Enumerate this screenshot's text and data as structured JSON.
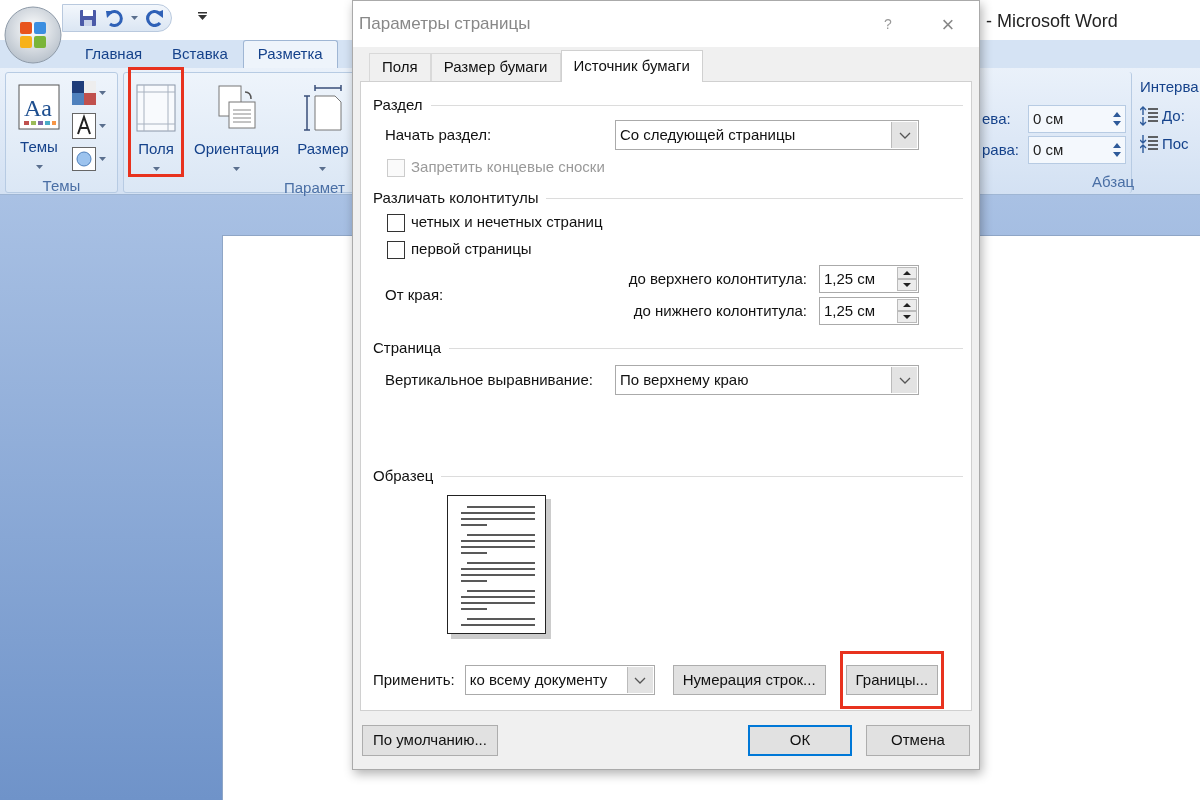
{
  "word": {
    "title": "- Microsoft Word",
    "ribbon_tabs": [
      {
        "label": "Главная",
        "selected": false
      },
      {
        "label": "Вставка",
        "selected": false
      },
      {
        "label": "Разметка",
        "selected": true
      }
    ],
    "ribbon_groups": [
      {
        "label": "Темы",
        "buttons": [
          {
            "label": "Темы",
            "kind": "themes",
            "icon_text": "Aa",
            "highlighted": false
          }
        ]
      },
      {
        "label": "Парамет",
        "buttons": [
          {
            "label": "Поля",
            "kind": "margins",
            "highlighted": true
          },
          {
            "label": "Ориентация",
            "kind": "orientation",
            "highlighted": false
          },
          {
            "label": "Размер",
            "kind": "size",
            "highlighted": false
          }
        ]
      }
    ],
    "indent_fields": [
      {
        "label": "ева:",
        "value": "0 см"
      },
      {
        "label": "рава:",
        "value": "0 см"
      }
    ],
    "paragraph_group_label": "Абзац",
    "spacing_group": {
      "label": "Интерва",
      "items": [
        {
          "label": "До:",
          "kind": "before"
        },
        {
          "label": "Пос",
          "kind": "after"
        }
      ]
    }
  },
  "dialog": {
    "title": "Параметры страницы",
    "help": "?",
    "close": "×",
    "tabs": [
      {
        "label": "Поля",
        "selected": false
      },
      {
        "label": "Размер бумаги",
        "selected": false
      },
      {
        "label": "Источник бумаги",
        "selected": true
      }
    ],
    "section_start": {
      "heading": "Раздел",
      "label": "Начать раздел:",
      "value": "Со следующей страницы",
      "suppress_endnotes": {
        "label": "Запретить концевые сноски",
        "checked": false,
        "disabled": true
      }
    },
    "headers_footers": {
      "heading": "Различать колонтитулы",
      "options": [
        {
          "label": "четных и нечетных страниц",
          "checked": false
        },
        {
          "label": "первой страницы",
          "checked": false
        }
      ],
      "from_edge_label": "От края:",
      "distances": [
        {
          "label": "до верхнего колонтитула:",
          "value": "1,25 см"
        },
        {
          "label": "до нижнего колонтитула:",
          "value": "1,25 см"
        }
      ]
    },
    "page": {
      "heading": "Страница",
      "label": "Вертикальное выравнивание:",
      "value": "По верхнему краю"
    },
    "preview": {
      "heading": "Образец"
    },
    "apply": {
      "label": "Применить:",
      "value": "ко всему документу"
    },
    "panel_buttons": [
      {
        "label": "Нумерация строк...",
        "highlighted": false
      },
      {
        "label": "Границы...",
        "highlighted": true
      }
    ],
    "footer_buttons": [
      {
        "label": "По умолчанию...",
        "default": false
      },
      {
        "label": "ОК",
        "default": true
      },
      {
        "label": "Отмена",
        "default": false
      }
    ]
  }
}
